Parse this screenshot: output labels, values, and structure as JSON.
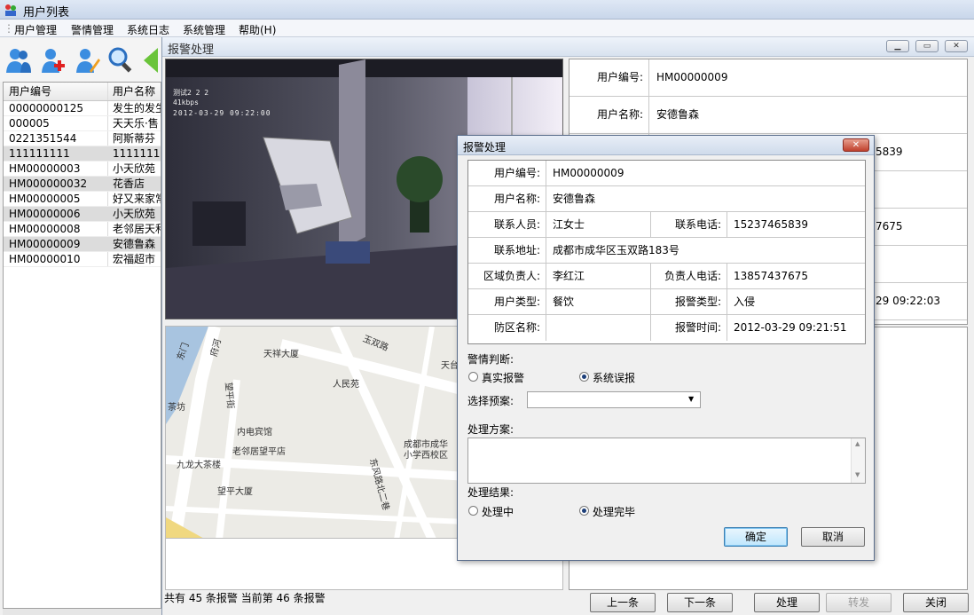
{
  "window": {
    "title": "用户列表"
  },
  "menu": [
    "用户管理",
    "警情管理",
    "系统日志",
    "系统管理",
    "帮助(H)"
  ],
  "toolbar": {
    "icons": [
      "users-icon",
      "add-user-icon",
      "edit-user-icon",
      "search-icon",
      "back-arrow-icon"
    ]
  },
  "user_table": {
    "columns": [
      "用户编号",
      "用户名称"
    ],
    "rows": [
      [
        "00000000125",
        "发生的发生"
      ],
      [
        "000005",
        "天天乐·售"
      ],
      [
        "0221351544",
        "阿斯蒂芬"
      ],
      [
        "111111111",
        "111111111"
      ],
      [
        "HM00000003",
        "小天欣苑"
      ],
      [
        "HM000000032",
        "花香店"
      ],
      [
        "HM00000005",
        "好又来家常"
      ],
      [
        "HM00000006",
        "小天欣苑"
      ],
      [
        "HM00000008",
        "老邻居天和"
      ],
      [
        "HM00000009",
        "安德鲁森"
      ],
      [
        "HM00000010",
        "宏福超市"
      ]
    ]
  },
  "child": {
    "title": "报警处理",
    "video": {
      "osd_line1": "测试2 2 2",
      "osd_line2": "41kbps",
      "osd_line3": "2012-03-29 09:22:00"
    },
    "map_labels": [
      "天祥大厦",
      "人民苑",
      "玉双路",
      "天台",
      "内电宾馆",
      "老邻居望平店",
      "成都市成华",
      "小学西校区",
      "九龙大茶楼",
      "望平大厦",
      "东风路北二巷",
      "望平街",
      "茶坊",
      "东门",
      "府河"
    ],
    "status": "共有 45 条报警 当前第 46 条报警",
    "info": [
      {
        "label": "用户编号:",
        "value": "HM00000009"
      },
      {
        "label": "用户名称:",
        "value": "安德鲁森"
      },
      {
        "label": "",
        "value": "5839"
      },
      {
        "label": "",
        "value": ""
      },
      {
        "label": "",
        "value": "7675"
      },
      {
        "label": "",
        "value": ""
      },
      {
        "label": "",
        "value": "29 09:22:03"
      }
    ],
    "buttons": {
      "prev": "上一条",
      "next": "下一条",
      "process": "处理",
      "forward": "转发",
      "close": "关闭"
    }
  },
  "dialog": {
    "title": "报警处理",
    "close": "✕",
    "grid": {
      "user_id_label": "用户编号:",
      "user_id": "HM00000009",
      "user_name_label": "用户名称:",
      "user_name": "安德鲁森",
      "contact_label": "联系人员:",
      "contact": "江女士",
      "phone_label": "联系电话:",
      "phone": "15237465839",
      "address_label": "联系地址:",
      "address": "成都市成华区玉双路183号",
      "area_mgr_label": "区域负责人:",
      "area_mgr": "李红江",
      "mgr_phone_label": "负责人电话:",
      "mgr_phone": "13857437675",
      "user_type_label": "用户类型:",
      "user_type": "餐饮",
      "alarm_type_label": "报警类型:",
      "alarm_type": "入侵",
      "zone_label": "防区名称:",
      "zone": "",
      "alarm_time_label": "报警时间:",
      "alarm_time": "2012-03-29 09:21:51"
    },
    "judgement_label": "警情判断:",
    "judgement_options": [
      "真实报警",
      "系统误报"
    ],
    "judgement_selected": "系统误报",
    "plan_label": "选择预案:",
    "plan_value": "",
    "method_label": "处理方案:",
    "method_value": "",
    "result_label": "处理结果:",
    "result_options": [
      "处理中",
      "处理完毕"
    ],
    "result_selected": "处理完毕",
    "ok": "确定",
    "cancel": "取消"
  }
}
